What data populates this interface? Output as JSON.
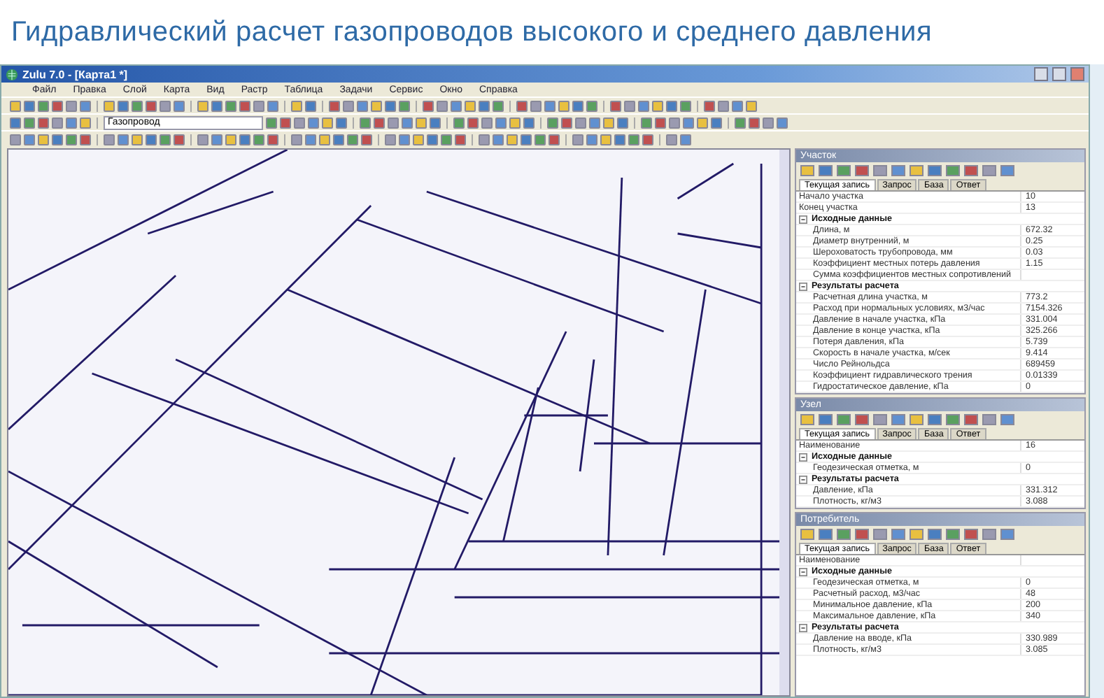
{
  "slide_title": "Гидравлический расчет газопроводов высокого и среднего давления",
  "window": {
    "title": "Zulu 7.0 - [Карта1 *]"
  },
  "menu": [
    "Файл",
    "Правка",
    "Слой",
    "Карта",
    "Вид",
    "Растр",
    "Таблица",
    "Задачи",
    "Сервис",
    "Окно",
    "Справка"
  ],
  "layer_field": {
    "value": "Газопровод"
  },
  "panels": [
    {
      "title": "Участок",
      "tabs": [
        {
          "label": "Текущая запись",
          "selected": true
        },
        {
          "label": "Запрос",
          "selected": false
        },
        {
          "label": "База",
          "selected": false
        },
        {
          "label": "Ответ",
          "selected": false
        }
      ],
      "rows": [
        {
          "kind": "field",
          "label": "Начало участка",
          "value": "10"
        },
        {
          "kind": "field",
          "label": "Конец участка",
          "value": "13"
        },
        {
          "kind": "group",
          "label": "Исходные данные",
          "expanded": true,
          "children": [
            {
              "kind": "field",
              "label": "Длина, м",
              "value": "672.32"
            },
            {
              "kind": "field",
              "label": "Диаметр внутренний, м",
              "value": "0.25"
            },
            {
              "kind": "field",
              "label": "Шероховатость трубопровода, мм",
              "value": "0.03"
            },
            {
              "kind": "field",
              "label": "Коэффициент местных потерь давления",
              "value": "1.15"
            },
            {
              "kind": "field",
              "label": "Сумма коэффициентов местных сопротивлений"
            }
          ]
        },
        {
          "kind": "group",
          "label": "Результаты расчета",
          "expanded": true,
          "children": [
            {
              "kind": "field",
              "label": "Расчетная длина участка, м",
              "value": "773.2"
            },
            {
              "kind": "field",
              "label": "Расход при нормальных условиях, м3/час",
              "value": "7154.326"
            },
            {
              "kind": "field",
              "label": "Давление в начале участка, кПа",
              "value": "331.004"
            },
            {
              "kind": "field",
              "label": "Давление в конце участка, кПа",
              "value": "325.266"
            },
            {
              "kind": "field",
              "label": "Потеря давления, кПа",
              "value": "5.739"
            },
            {
              "kind": "field",
              "label": "Скорость в начале участка, м/сек",
              "value": "9.414"
            },
            {
              "kind": "field",
              "label": "Число Рейнольдса",
              "value": "689459"
            },
            {
              "kind": "field",
              "label": "Коэффициент гидравлического трения",
              "value": "0.01339"
            },
            {
              "kind": "field",
              "label": "Гидростатическое давление, кПа",
              "value": "0"
            }
          ]
        }
      ]
    },
    {
      "title": "Узел",
      "tabs": [
        {
          "label": "Текущая запись",
          "selected": true
        },
        {
          "label": "Запрос",
          "selected": false
        },
        {
          "label": "База",
          "selected": false
        },
        {
          "label": "Ответ",
          "selected": false
        }
      ],
      "rows": [
        {
          "kind": "field",
          "label": "Наименование",
          "value": "16"
        },
        {
          "kind": "group",
          "label": "Исходные данные",
          "expanded": true,
          "children": [
            {
              "kind": "field",
              "label": "Геодезическая отметка, м",
              "value": "0"
            }
          ]
        },
        {
          "kind": "group",
          "label": "Результаты расчета",
          "expanded": true,
          "children": [
            {
              "kind": "field",
              "label": "Давление, кПа",
              "value": "331.312"
            },
            {
              "kind": "field",
              "label": "Плотность, кг/м3",
              "value": "3.088"
            }
          ]
        }
      ]
    },
    {
      "title": "Потребитель",
      "tabs": [
        {
          "label": "Текущая запись",
          "selected": true
        },
        {
          "label": "Запрос",
          "selected": false
        },
        {
          "label": "База",
          "selected": false
        },
        {
          "label": "Ответ",
          "selected": false
        }
      ],
      "rows": [
        {
          "kind": "field",
          "label": "Наименование"
        },
        {
          "kind": "group",
          "label": "Исходные данные",
          "expanded": true,
          "children": [
            {
              "kind": "field",
              "label": "Геодезическая отметка, м",
              "value": "0"
            },
            {
              "kind": "field",
              "label": "Расчетный расход, м3/час",
              "value": "48"
            },
            {
              "kind": "field",
              "label": "Минимальное давление,  кПа",
              "value": "200"
            },
            {
              "kind": "field",
              "label": "Максимальное давление,  кПа",
              "value": "340"
            }
          ]
        },
        {
          "kind": "group",
          "label": "Результаты расчета",
          "expanded": true,
          "children": [
            {
              "kind": "field",
              "label": "Давление на вводе,  кПа",
              "value": "330.989"
            },
            {
              "kind": "field",
              "label": "Плотность, кг/м3",
              "value": "3.085"
            }
          ]
        }
      ]
    }
  ]
}
